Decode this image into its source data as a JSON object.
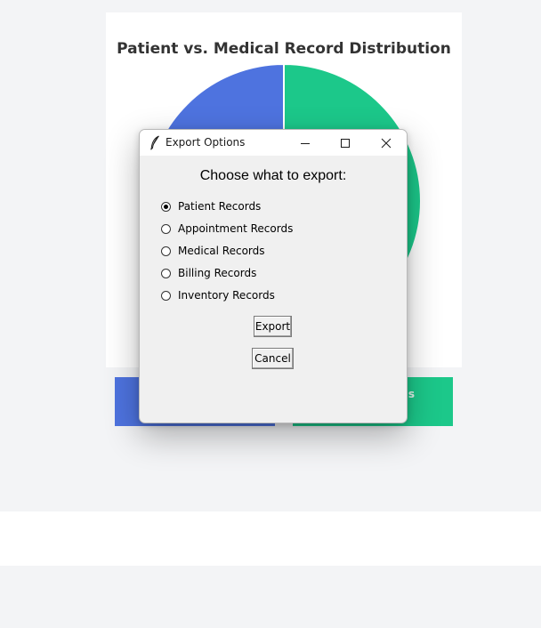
{
  "background": {
    "chart_title": "Patient vs. Medical Record Distribution",
    "stat_card_green_label": "ls",
    "colors": {
      "page_bg": "#f3f4f6",
      "series_blue": "#4e73df",
      "series_green": "#1cc88a"
    }
  },
  "chart_data": {
    "type": "pie",
    "title": "Patient vs. Medical Record Distribution",
    "slices": [
      {
        "color": "#1cc88a",
        "value": 50
      },
      {
        "color": "#4e73df",
        "value": 50
      }
    ]
  },
  "dialog": {
    "title": "Export Options",
    "app_icon": "feather-icon",
    "controls": {
      "minimize_icon": "minimize-icon",
      "maximize_icon": "maximize-icon",
      "close_icon": "close-icon"
    },
    "heading": "Choose what to export:",
    "options": [
      {
        "label": "Patient Records",
        "checked": true
      },
      {
        "label": "Appointment Records",
        "checked": false
      },
      {
        "label": "Medical Records",
        "checked": false
      },
      {
        "label": "Billing Records",
        "checked": false
      },
      {
        "label": "Inventory Records",
        "checked": false
      }
    ],
    "export_label": "Export",
    "cancel_label": "Cancel"
  }
}
